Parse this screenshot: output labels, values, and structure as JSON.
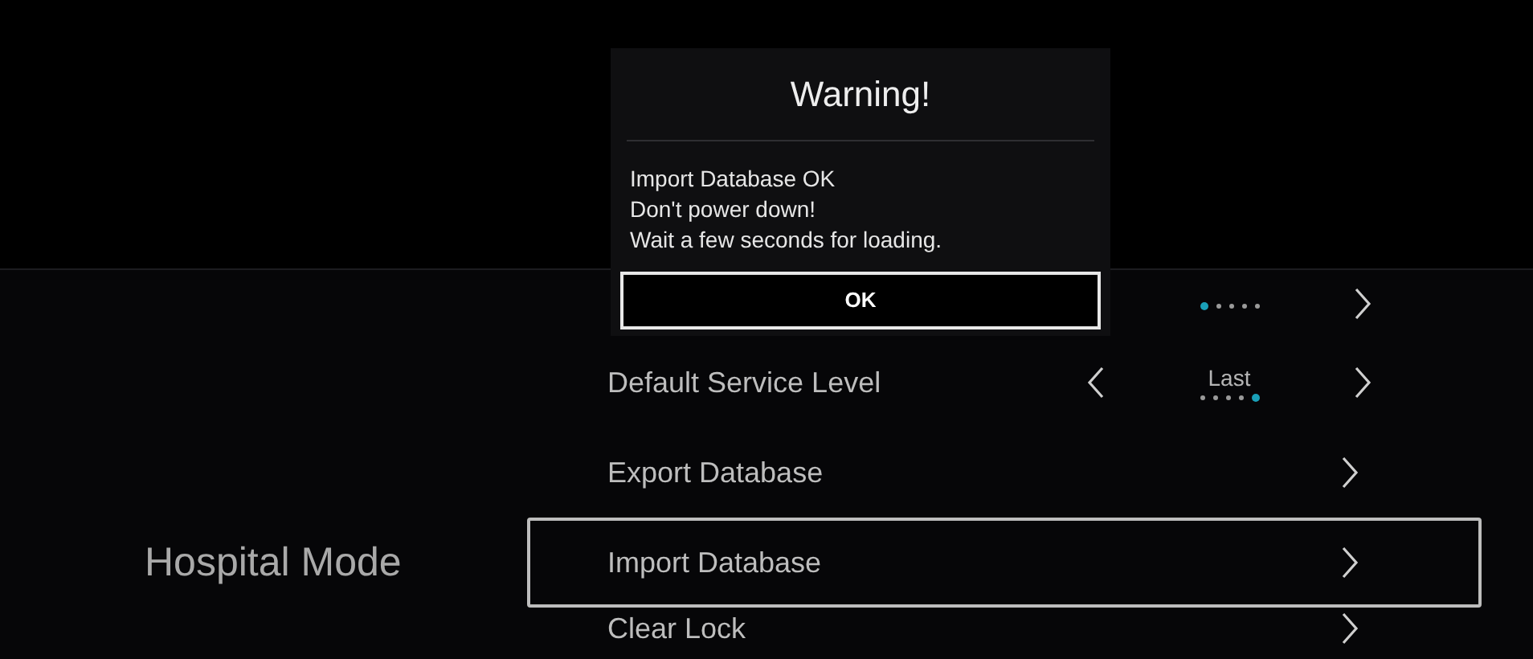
{
  "section": {
    "title": "Hospital Mode"
  },
  "rows": [
    {
      "kind": "selector",
      "label": "",
      "value": "",
      "dots": [
        {
          "selected": true
        },
        {
          "selected": false
        },
        {
          "selected": false
        },
        {
          "selected": false
        },
        {
          "selected": false
        }
      ],
      "selected": false
    },
    {
      "kind": "selector",
      "label": "Default Service Level",
      "value": "Last",
      "dots": [
        {
          "selected": false
        },
        {
          "selected": false
        },
        {
          "selected": false
        },
        {
          "selected": false
        },
        {
          "selected": true
        }
      ],
      "selected": false
    },
    {
      "kind": "link",
      "label": "Export Database",
      "selected": false
    },
    {
      "kind": "link",
      "label": "Import Database",
      "selected": true
    },
    {
      "kind": "link",
      "label": "Clear Lock",
      "selected": false
    }
  ],
  "dialog": {
    "title": "Warning!",
    "lines": [
      "Import Database OK",
      "Don't power down!",
      "Wait a few seconds for loading."
    ],
    "button": "OK"
  }
}
